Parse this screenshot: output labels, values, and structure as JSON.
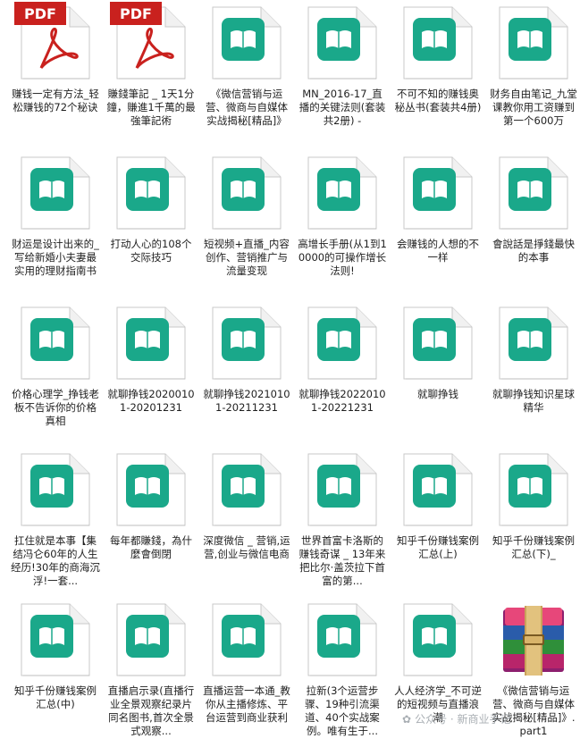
{
  "files": [
    {
      "label": "赚钱一定有方法_轻松赚钱的72个秘诀",
      "icon": "pdf-icon"
    },
    {
      "label": "賺錢筆記 _ 1天1分鐘，賺進1千萬的最強筆記術",
      "icon": "pdf-icon"
    },
    {
      "label": "《微信营销与运营、微商与自媒体实战揭秘[精品]》",
      "icon": "ebook-icon"
    },
    {
      "label": "MN_2016-17_直播的关键法则(套装共2册) -",
      "icon": "ebook-icon"
    },
    {
      "label": "不可不知的赚钱奥秘丛书(套装共4册)",
      "icon": "ebook-icon"
    },
    {
      "label": "财务自由笔记_九堂课教你用工资赚到第一个600万",
      "icon": "ebook-icon"
    },
    {
      "label": "财运是设计出来的_写给新婚小夫妻最实用的理财指南书",
      "icon": "ebook-icon"
    },
    {
      "label": "打动人心的108个交际技巧",
      "icon": "ebook-icon"
    },
    {
      "label": "短视频+直播_内容创作、营销推广与流量变现",
      "icon": "ebook-icon"
    },
    {
      "label": "高增长手册(从1到10000的可操作增长法则!",
      "icon": "ebook-icon"
    },
    {
      "label": "会赚钱的人想的不一样",
      "icon": "ebook-icon"
    },
    {
      "label": "會說話是掙錢最快的本事",
      "icon": "ebook-icon"
    },
    {
      "label": "价格心理学_挣钱老板不告诉你的价格真相",
      "icon": "ebook-icon"
    },
    {
      "label": "就聊挣钱20200101-20201231",
      "icon": "ebook-icon"
    },
    {
      "label": "就聊挣钱20210101-20211231",
      "icon": "ebook-icon"
    },
    {
      "label": "就聊挣钱20220101-20221231",
      "icon": "ebook-icon"
    },
    {
      "label": "就聊挣钱",
      "icon": "ebook-icon"
    },
    {
      "label": "就聊挣钱知识星球精华",
      "icon": "ebook-icon"
    },
    {
      "label": "扛住就是本事【集结冯仑60年的人生经历!30年的商海沉浮!一套...",
      "icon": "ebook-icon"
    },
    {
      "label": "每年都賺錢，為什麼會倒閉",
      "icon": "ebook-icon"
    },
    {
      "label": "深度微信 _ 营销,运营,创业与微信电商",
      "icon": "ebook-icon"
    },
    {
      "label": "世界首富卡洛斯的赚钱奇谋 _ 13年来把比尔·盖茨拉下首富的第...",
      "icon": "ebook-icon"
    },
    {
      "label": "知乎千份赚钱案例汇总(上)",
      "icon": "ebook-icon"
    },
    {
      "label": "知乎千份赚钱案例汇总(下)_",
      "icon": "ebook-icon"
    },
    {
      "label": "知乎千份赚钱案例汇总(中)",
      "icon": "ebook-icon"
    },
    {
      "label": "直播启示录(直播行业全景观察纪录片同名图书,首次全景式观察...",
      "icon": "ebook-icon"
    },
    {
      "label": "直播运营一本通_教你从主播修炼、平台运营到商业获利",
      "icon": "ebook-icon"
    },
    {
      "label": "拉新(3个运营步骤、19种引流渠道、40个实战案例。唯有生于...",
      "icon": "ebook-icon"
    },
    {
      "label": "人人经济学_不可逆的短视频与直播浪潮",
      "icon": "ebook-icon"
    },
    {
      "label": "《微信营销与运营、微商与自媒体实战揭秘[精品]》.part1",
      "icon": "winrar-archive-icon"
    }
  ],
  "watermark": "公众号 · 新商业手记",
  "colors": {
    "ebook": "#1aa88a",
    "pdf_red": "#c9211e"
  }
}
